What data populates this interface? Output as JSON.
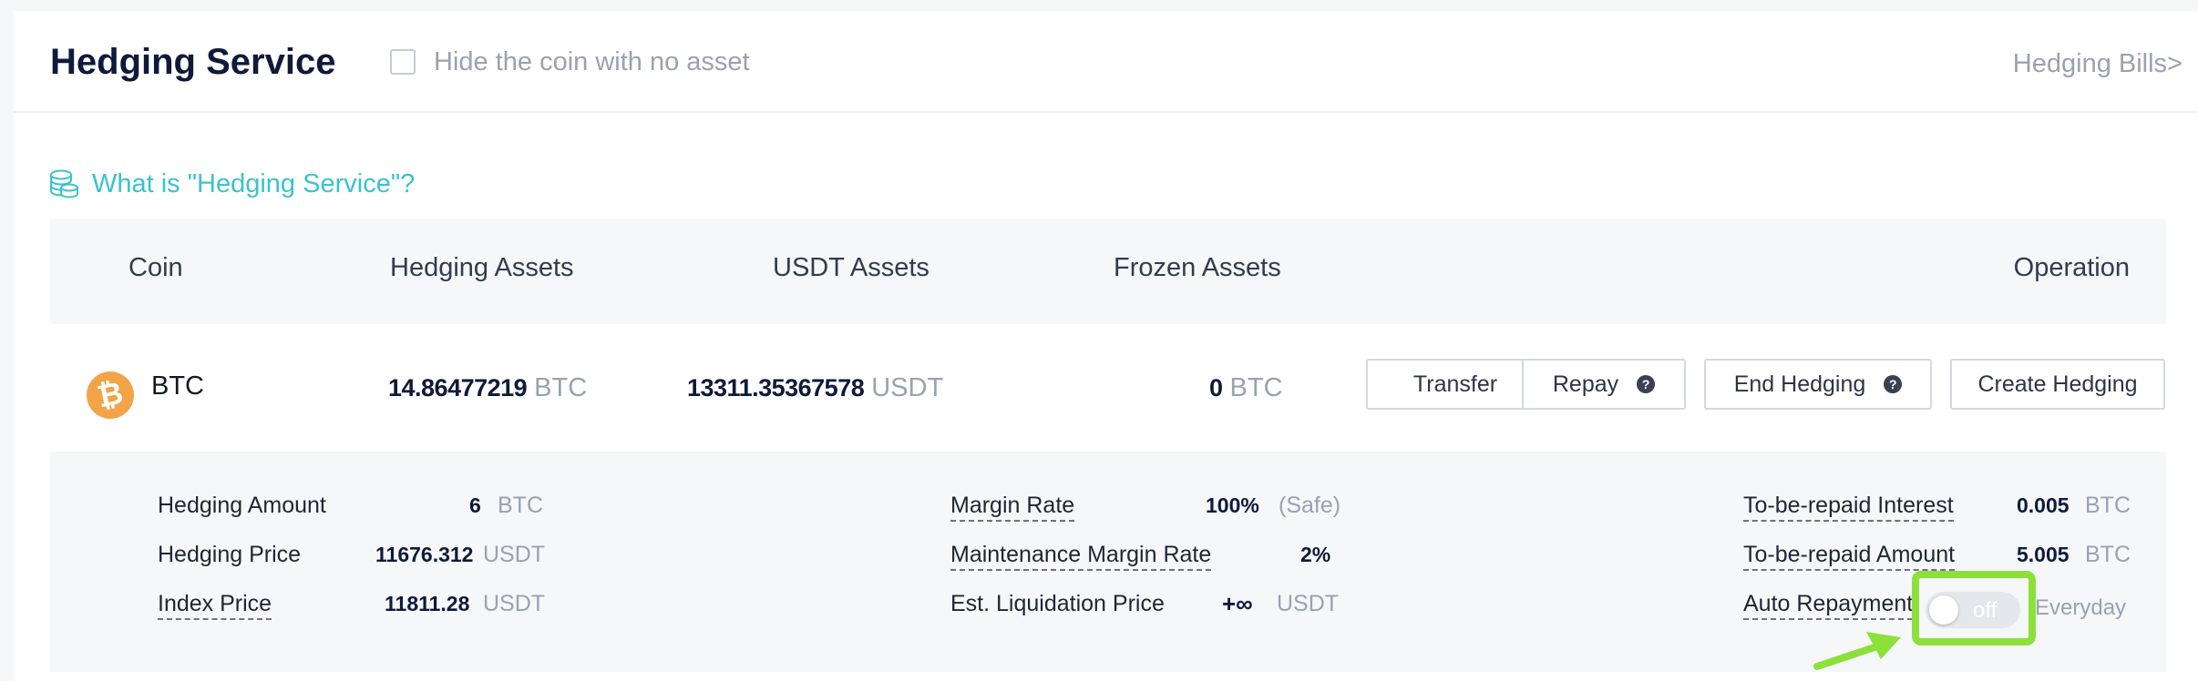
{
  "header": {
    "title": "Hedging Service",
    "hide_zero_label": "Hide the coin with no asset",
    "bills_link": "Hedging Bills>"
  },
  "info_link": "What is \"Hedging Service\"?",
  "table": {
    "columns": [
      "Coin",
      "Hedging Assets",
      "USDT Assets",
      "Frozen Assets",
      "Operation"
    ],
    "row": {
      "coin": "BTC",
      "coin_symbol": "₿",
      "hedging_assets": {
        "value": "14.86477219",
        "unit": "BTC"
      },
      "usdt_assets": {
        "value": "13311.35367578",
        "unit": "USDT"
      },
      "frozen_assets": {
        "value": "0",
        "unit": "BTC"
      },
      "actions": {
        "transfer": "Transfer",
        "repay": "Repay",
        "end_hedging": "End Hedging",
        "create_hedging": "Create Hedging",
        "help_glyph": "?"
      }
    }
  },
  "details": {
    "hedging_amount": {
      "label": "Hedging Amount",
      "value": "6",
      "unit": "BTC"
    },
    "hedging_price": {
      "label": "Hedging Price",
      "value": "11676.312",
      "unit": "USDT"
    },
    "index_price": {
      "label": "Index Price",
      "value": "11811.28",
      "unit": "USDT"
    },
    "margin_rate": {
      "label": "Margin Rate",
      "value": "100%",
      "unit": "(Safe)"
    },
    "maintenance_margin_rate": {
      "label": "Maintenance Margin Rate",
      "value": "2%"
    },
    "liquidation_price": {
      "label": "Est. Liquidation Price",
      "value": "+∞",
      "unit": "USDT"
    },
    "repaid_interest": {
      "label": "To-be-repaid Interest",
      "value": "0.005",
      "unit": "BTC"
    },
    "repaid_amount": {
      "label": "To-be-repaid Amount",
      "value": "5.005",
      "unit": "BTC"
    },
    "auto_repayment": {
      "label": "Auto Repayment",
      "state": "off",
      "frequency": "Everyday"
    }
  },
  "colors": {
    "accent": "#3bc3c9",
    "btc": "#f2a446",
    "highlight": "#8be13a"
  }
}
